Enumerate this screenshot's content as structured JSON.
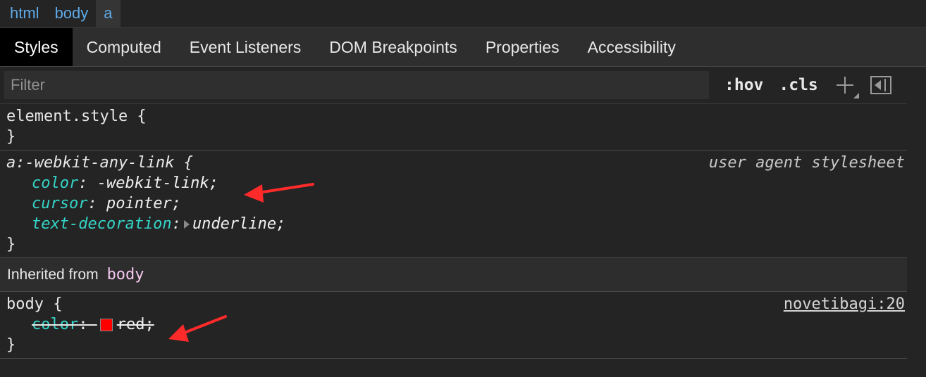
{
  "breadcrumb": {
    "items": [
      {
        "label": "html",
        "active": false
      },
      {
        "label": "body",
        "active": false
      },
      {
        "label": "a",
        "active": true
      }
    ]
  },
  "tabs": [
    {
      "label": "Styles",
      "active": true
    },
    {
      "label": "Computed",
      "active": false
    },
    {
      "label": "Event Listeners",
      "active": false
    },
    {
      "label": "DOM Breakpoints",
      "active": false
    },
    {
      "label": "Properties",
      "active": false
    },
    {
      "label": "Accessibility",
      "active": false
    }
  ],
  "toolbar": {
    "filter_placeholder": "Filter",
    "hov_label": ":hov",
    "cls_label": ".cls",
    "add_icon": "plus-icon",
    "toggle_icon": "sidebar-toggle-icon"
  },
  "rules": {
    "element_style": {
      "selector": "element.style {",
      "close": "}"
    },
    "webkit_link": {
      "selector": "a:-webkit-any-link {",
      "source": "user agent stylesheet",
      "props": [
        {
          "name": "color",
          "value": "-webkit-link;"
        },
        {
          "name": "cursor",
          "value": "pointer;"
        },
        {
          "name": "text-decoration",
          "value": "underline;"
        }
      ],
      "close": "}"
    },
    "inherited": {
      "label": "Inherited from",
      "tag": "body"
    },
    "body_rule": {
      "selector": "body {",
      "source": "novetibagi:20",
      "props": [
        {
          "name": "color",
          "value": "red;",
          "swatch_color": "#ff0000",
          "overridden": true
        }
      ],
      "close": "}"
    }
  },
  "colors": {
    "property": "#35d4c7",
    "breadcrumb": "#5ea9e6",
    "annotation_arrow": "#ff2a2a"
  }
}
